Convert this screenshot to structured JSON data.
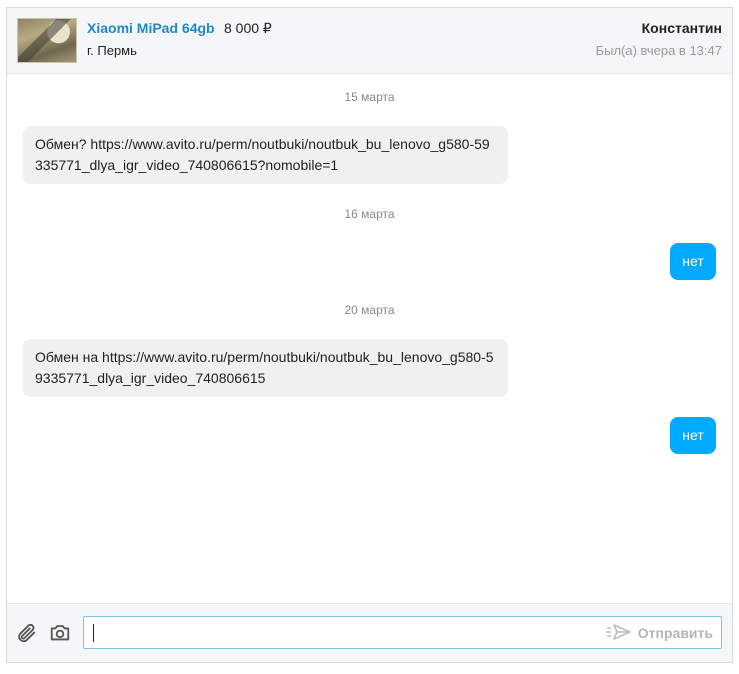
{
  "header": {
    "item_title": "Xiaomi MiPad 64gb",
    "item_price": "8 000 ₽",
    "item_city": "г. Пермь",
    "user_name": "Константин",
    "user_status": "Был(а) вчера в 13:47"
  },
  "messages": [
    {
      "type": "date",
      "text": "15 марта"
    },
    {
      "type": "incoming",
      "text": "Обмен? https://www.avito.ru/perm/noutbuki/noutbuk_bu_lenovo_g580-59335771_dlya_igr_video_740806615?nomobile=1"
    },
    {
      "type": "date",
      "text": "16 марта"
    },
    {
      "type": "outgoing",
      "text": "нет"
    },
    {
      "type": "date",
      "text": "20 марта"
    },
    {
      "type": "incoming",
      "text": "Обмен на https://www.avito.ru/perm/noutbuki/noutbuk_bu_lenovo_g580-59335771_dlya_igr_video_740806615"
    },
    {
      "type": "outgoing",
      "text": "нет"
    }
  ],
  "composer": {
    "input_value": "",
    "send_label": "Отправить",
    "attach_icon": "paperclip-icon",
    "camera_icon": "camera-icon",
    "send_icon": "send-plane-icon"
  },
  "colors": {
    "accent": "#00aaff",
    "link": "#1e88c9",
    "header_bg": "#f5f6f8",
    "incoming_bubble": "#f0f0f0"
  }
}
